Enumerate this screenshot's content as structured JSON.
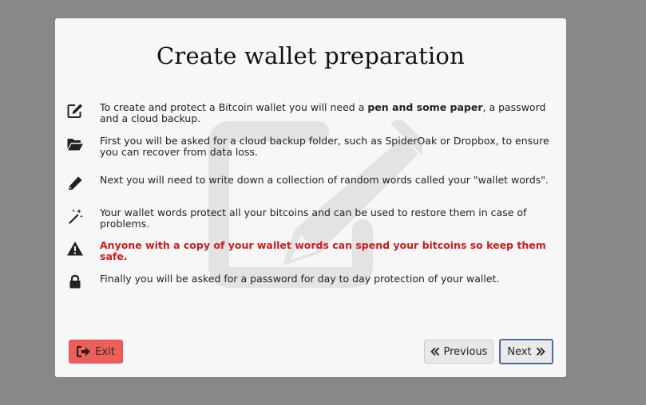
{
  "dialog": {
    "title": "Create wallet preparation",
    "items": [
      {
        "icon": "edit-square-icon",
        "segments": [
          {
            "text": "To create and protect a Bitcoin wallet you will need a ",
            "bold": false
          },
          {
            "text": "pen and some paper",
            "bold": true
          },
          {
            "text": ", a password and a cloud backup.",
            "bold": false
          }
        ]
      },
      {
        "icon": "folder-open-icon",
        "text": "First you will be asked for a cloud backup folder, such as SpiderOak or Dropbox, to ensure you can recover from data loss."
      },
      {
        "icon": "pencil-icon",
        "text": "Next you will need to write down a collection of random words called your \"wallet words\"."
      },
      {
        "icon": "magic-wand-icon",
        "text": "Your wallet words protect all your bitcoins and can be used to restore them in case of problems."
      },
      {
        "icon": "warning-icon",
        "text": "Anyone with a copy of your wallet words can spend your bitcoins so keep them safe.",
        "color": "#d11b1b"
      },
      {
        "icon": "lock-icon",
        "text": "Finally you will be asked for a password for day to day protection of your wallet."
      }
    ],
    "buttons": {
      "exit": {
        "label": "Exit",
        "icon": "sign-out-icon",
        "color": "#ee5f5b"
      },
      "previous": {
        "label": "Previous",
        "icon": "double-chevron-left-icon"
      },
      "next": {
        "label": "Next",
        "icon": "double-chevron-right-icon"
      }
    },
    "watermark_icon": "edit-square-icon"
  }
}
